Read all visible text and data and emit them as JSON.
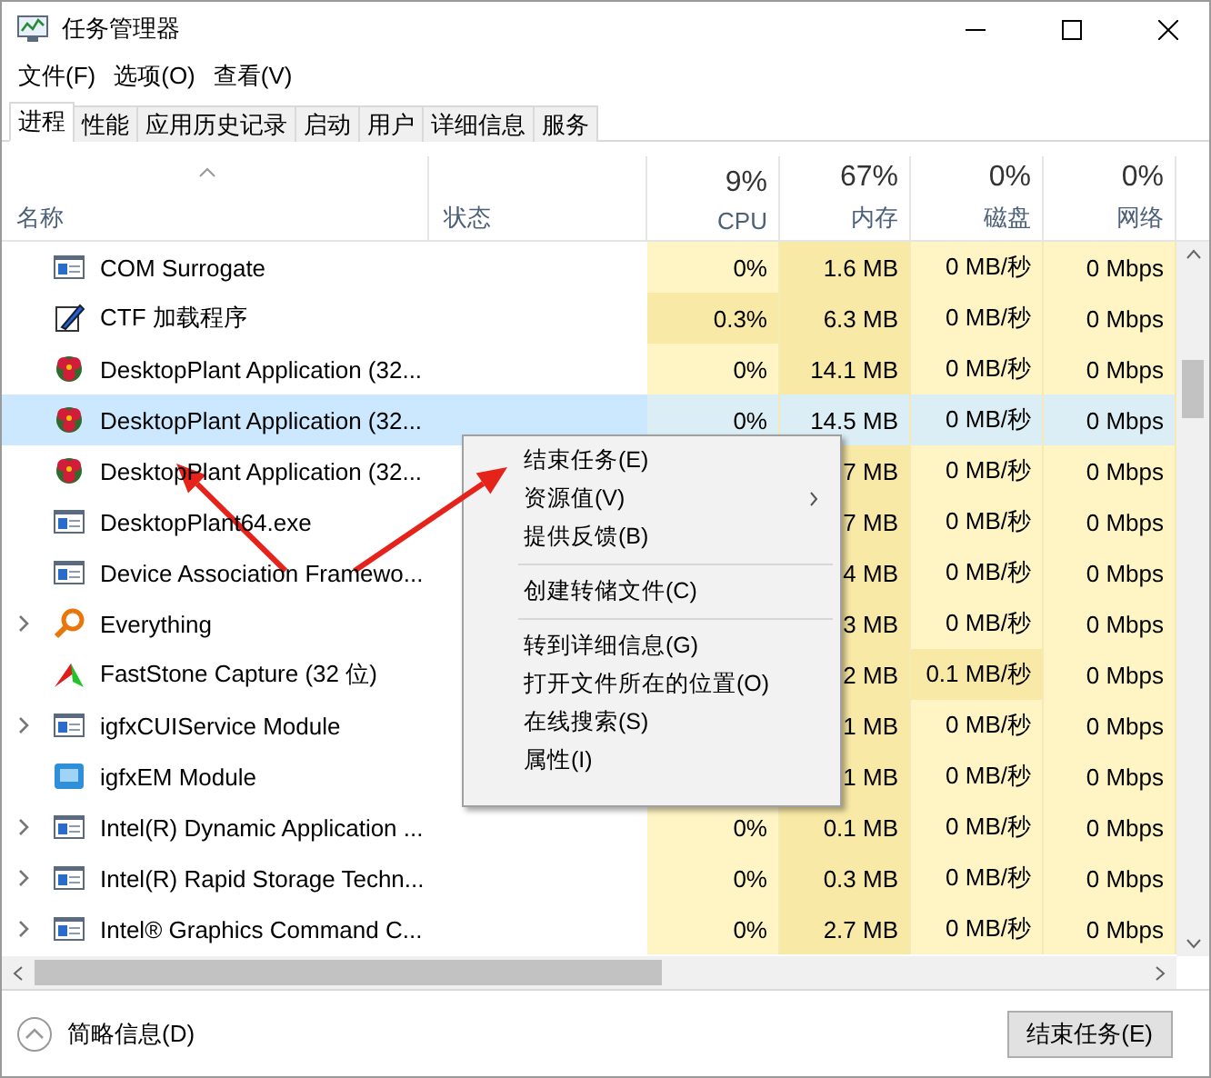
{
  "window": {
    "title": "任务管理器"
  },
  "menu_bar": [
    "文件(F)",
    "选项(O)",
    "查看(V)"
  ],
  "tabs": [
    {
      "label": "进程",
      "selected": true
    },
    {
      "label": "性能",
      "selected": false
    },
    {
      "label": "应用历史记录",
      "selected": false
    },
    {
      "label": "启动",
      "selected": false
    },
    {
      "label": "用户",
      "selected": false
    },
    {
      "label": "详细信息",
      "selected": false
    },
    {
      "label": "服务",
      "selected": false
    }
  ],
  "columns": [
    {
      "label": "名称"
    },
    {
      "label": "状态"
    },
    {
      "label": "CPU",
      "usage": "9%"
    },
    {
      "label": "内存",
      "usage": "67%"
    },
    {
      "label": "磁盘",
      "usage": "0%"
    },
    {
      "label": "网络",
      "usage": "0%"
    }
  ],
  "rows": [
    {
      "name": "COM Surrogate",
      "kind": "window",
      "expandable": false,
      "selected": false,
      "cells": [
        {
          "text": "0%",
          "hot": false
        },
        {
          "text": "1.6 MB",
          "hot": true
        },
        {
          "text": "0 MB/秒",
          "hot": false
        },
        {
          "text": "0 Mbps",
          "hot": false
        }
      ]
    },
    {
      "name": "CTF 加载程序",
      "kind": "pen",
      "expandable": false,
      "selected": false,
      "cells": [
        {
          "text": "0.3%",
          "hot": true
        },
        {
          "text": "6.3 MB",
          "hot": true
        },
        {
          "text": "0 MB/秒",
          "hot": false
        },
        {
          "text": "0 Mbps",
          "hot": false
        }
      ]
    },
    {
      "name": "DesktopPlant Application (32...",
      "kind": "flower",
      "expandable": false,
      "selected": false,
      "cells": [
        {
          "text": "0%",
          "hot": false
        },
        {
          "text": "14.1 MB",
          "hot": true
        },
        {
          "text": "0 MB/秒",
          "hot": false
        },
        {
          "text": "0 Mbps",
          "hot": false
        }
      ]
    },
    {
      "name": "DesktopPlant Application (32...",
      "kind": "flower",
      "expandable": false,
      "selected": true,
      "cells": [
        {
          "text": "0%"
        },
        {
          "text": "14.5 MB"
        },
        {
          "text": "0 MB/秒"
        },
        {
          "text": "0 Mbps"
        }
      ]
    },
    {
      "name": "DesktopPlant Application (32...",
      "kind": "flower",
      "expandable": false,
      "selected": false,
      "cells": [
        null,
        {
          "text": "7 MB",
          "hot": true
        },
        {
          "text": "0 MB/秒",
          "hot": false
        },
        {
          "text": "0 Mbps",
          "hot": false
        }
      ]
    },
    {
      "name": "DesktopPlant64.exe",
      "kind": "window",
      "expandable": false,
      "selected": false,
      "cells": [
        null,
        {
          "text": "7 MB",
          "hot": true
        },
        {
          "text": "0 MB/秒",
          "hot": false
        },
        {
          "text": "0 Mbps",
          "hot": false
        }
      ]
    },
    {
      "name": "Device Association Framewo...",
      "kind": "window",
      "expandable": false,
      "selected": false,
      "cells": [
        null,
        {
          "text": "4 MB",
          "hot": true
        },
        {
          "text": "0 MB/秒",
          "hot": false
        },
        {
          "text": "0 Mbps",
          "hot": false
        }
      ]
    },
    {
      "name": "Everything",
      "kind": "magnifier",
      "expandable": true,
      "selected": false,
      "cells": [
        null,
        {
          "text": "3 MB",
          "hot": true
        },
        {
          "text": "0 MB/秒",
          "hot": false
        },
        {
          "text": "0 Mbps",
          "hot": false
        }
      ]
    },
    {
      "name": "FastStone Capture (32 位)",
      "kind": "capture",
      "expandable": false,
      "selected": false,
      "cells": [
        null,
        {
          "text": "2 MB",
          "hot": true
        },
        {
          "text": "0.1 MB/秒",
          "hot": true
        },
        {
          "text": "0 Mbps",
          "hot": false
        }
      ]
    },
    {
      "name": "igfxCUIService Module",
      "kind": "window",
      "expandable": true,
      "selected": false,
      "cells": [
        null,
        {
          "text": "1 MB",
          "hot": true
        },
        {
          "text": "0 MB/秒",
          "hot": false
        },
        {
          "text": "0 Mbps",
          "hot": false
        }
      ]
    },
    {
      "name": "igfxEM Module",
      "kind": "monitor",
      "expandable": false,
      "selected": false,
      "cells": [
        null,
        {
          "text": "1 MB",
          "hot": true
        },
        {
          "text": "0 MB/秒",
          "hot": false
        },
        {
          "text": "0 Mbps",
          "hot": false
        }
      ]
    },
    {
      "name": "Intel(R) Dynamic Application ...",
      "kind": "window",
      "expandable": true,
      "selected": false,
      "cells": [
        {
          "text": "0%",
          "hot": false
        },
        {
          "text": "0.1 MB",
          "hot": true
        },
        {
          "text": "0 MB/秒",
          "hot": false
        },
        {
          "text": "0 Mbps",
          "hot": false
        }
      ]
    },
    {
      "name": "Intel(R) Rapid Storage Techn...",
      "kind": "window",
      "expandable": true,
      "selected": false,
      "cells": [
        {
          "text": "0%",
          "hot": false
        },
        {
          "text": "0.3 MB",
          "hot": true
        },
        {
          "text": "0 MB/秒",
          "hot": false
        },
        {
          "text": "0 Mbps",
          "hot": false
        }
      ]
    },
    {
      "name": "Intel® Graphics Command C...",
      "kind": "window",
      "expandable": true,
      "selected": false,
      "cells": [
        {
          "text": "0%",
          "hot": false
        },
        {
          "text": "2.7 MB",
          "hot": true
        },
        {
          "text": "0 MB/秒",
          "hot": false
        },
        {
          "text": "0 Mbps",
          "hot": false
        }
      ]
    }
  ],
  "context_menu": {
    "groups": [
      [
        {
          "label": "结束任务(E)",
          "submenu": false
        },
        {
          "label": "资源值(V)",
          "submenu": true
        },
        {
          "label": "提供反馈(B)",
          "submenu": false
        }
      ],
      [
        {
          "label": "创建转储文件(C)",
          "submenu": false
        }
      ],
      [
        {
          "label": "转到详细信息(G)",
          "submenu": false
        },
        {
          "label": "打开文件所在的位置(O)",
          "submenu": false
        },
        {
          "label": "在线搜索(S)",
          "submenu": false
        },
        {
          "label": "属性(I)",
          "submenu": false
        }
      ]
    ]
  },
  "footer": {
    "details_toggle": "简略信息(D)",
    "end_task_button": "结束任务(E)"
  }
}
